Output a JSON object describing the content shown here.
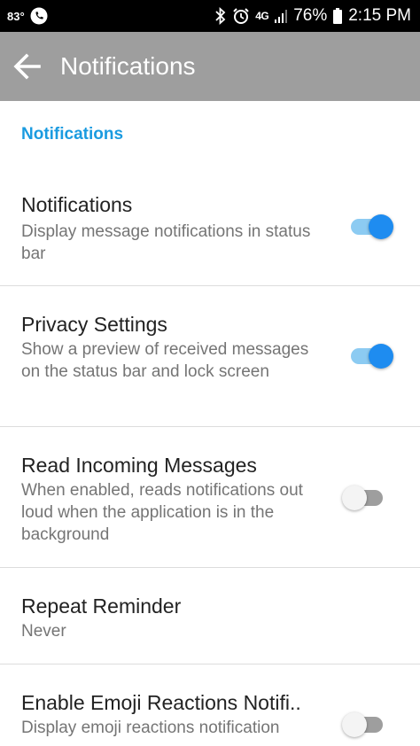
{
  "status_bar": {
    "temperature": "83°",
    "network": "4G",
    "battery": "76%",
    "time": "2:15 PM",
    "icons": [
      "phone-icon",
      "bluetooth-icon",
      "alarm-icon",
      "network-4g-icon",
      "signal-icon",
      "battery-icon"
    ]
  },
  "app_bar": {
    "title": "Notifications",
    "back_icon": "arrow-back-icon",
    "background_color": "#9e9e9e"
  },
  "section": {
    "header": "Notifications",
    "accent_color": "#1a9be0"
  },
  "settings": [
    {
      "title": "Notifications",
      "summary": "Display message notifications in status bar",
      "toggle": true
    },
    {
      "title": "Privacy Settings",
      "summary": "Show a preview of received messages on the status bar and lock screen",
      "toggle": true
    },
    {
      "title": "Read Incoming Messages",
      "summary": "When enabled, reads notifications out loud when the application is in the background",
      "toggle": false
    },
    {
      "title": "Repeat Reminder",
      "summary": "Never"
    },
    {
      "title": "Enable Emoji Reactions Notifi..",
      "summary": "Display emoji reactions notification",
      "toggle": false
    }
  ],
  "colors": {
    "toggle_on": "#1e8cf0",
    "toggle_on_track": "#8ccbf2",
    "toggle_off_track": "#9e9e9e"
  }
}
